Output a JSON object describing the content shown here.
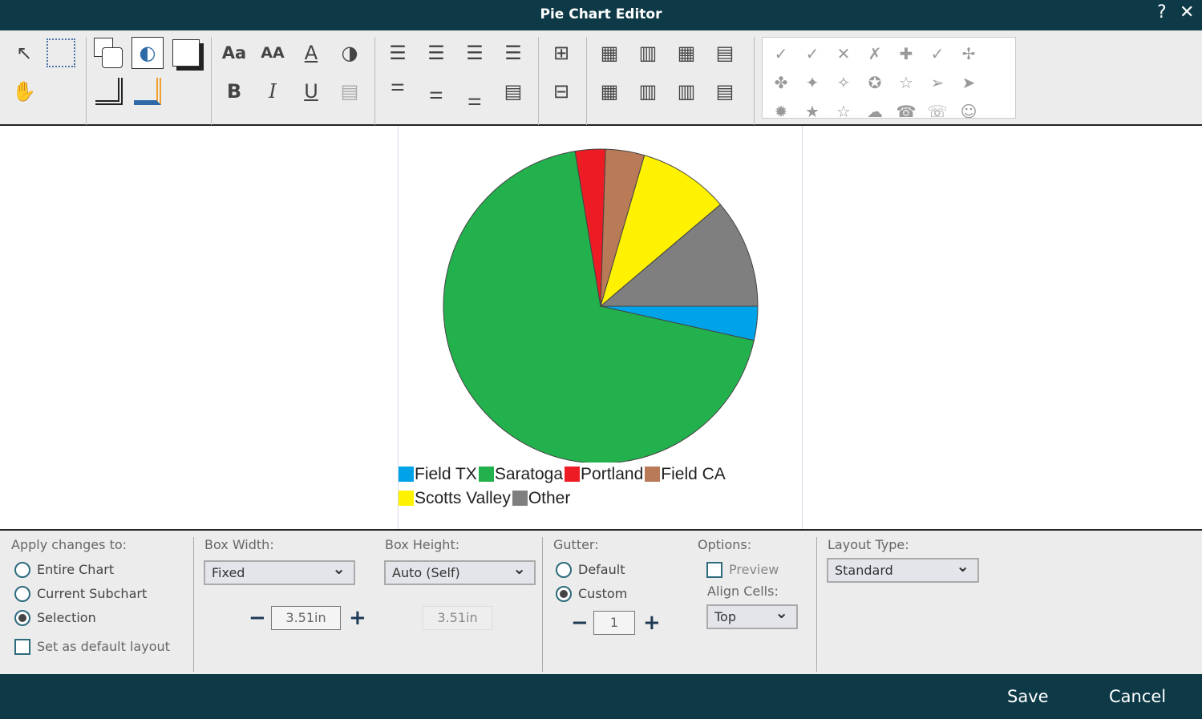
{
  "window": {
    "title": "Pie Chart Editor",
    "help": "?",
    "close": "✕"
  },
  "symbols": [
    "✓",
    "✓",
    "✕",
    "✗",
    "✚",
    "✓",
    "✢",
    "✤",
    "✦",
    "✧",
    "✪",
    "☆",
    "➢",
    "➤",
    "✹",
    "★",
    "☆",
    "☁",
    "☎",
    "☏",
    "☺"
  ],
  "chart_data": {
    "type": "pie",
    "slices": [
      {
        "name": "Field TX",
        "value": 3.5,
        "color": "#00a2e8"
      },
      {
        "name": "Saratoga",
        "value": 68.9,
        "color": "#22b14c"
      },
      {
        "name": "Portland",
        "value": 3.1,
        "color": "#ed1c24"
      },
      {
        "name": "Field CA",
        "value": 4.0,
        "color": "#b97a57"
      },
      {
        "name": "Scotts Valley",
        "value": 9.3,
        "color": "#fff200"
      },
      {
        "name": "Other",
        "value": 11.2,
        "color": "#7f7f7f"
      }
    ],
    "legend": "bottom"
  },
  "panel": {
    "apply_label": "Apply changes to:",
    "apply_options": [
      "Entire Chart",
      "Current Subchart",
      "Selection"
    ],
    "apply_selected": "Selection",
    "default_layout": "Set as default layout",
    "box_width_label": "Box Width:",
    "box_width_mode": "Fixed",
    "box_width_value": "3.51in",
    "box_height_label": "Box Height:",
    "box_height_mode": "Auto (Self)",
    "box_height_value": "3.51in",
    "gutter_label": "Gutter:",
    "gutter_options": [
      "Default",
      "Custom"
    ],
    "gutter_selected": "Custom",
    "gutter_value": "1",
    "options_label": "Options:",
    "preview": "Preview",
    "align_label": "Align Cells:",
    "align_value": "Top",
    "layout_label": "Layout Type:",
    "layout_value": "Standard",
    "minus": "−",
    "plus": "+"
  },
  "footer": {
    "save": "Save",
    "cancel": "Cancel"
  }
}
